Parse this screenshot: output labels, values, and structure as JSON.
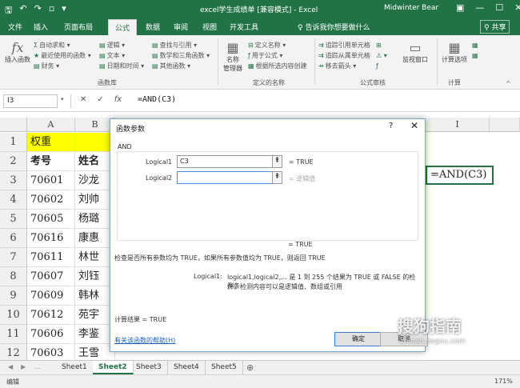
{
  "window": {
    "title": "excel学生成绩单 [兼容模式] - Excel",
    "user": "Midwinter Bear"
  },
  "ribbon_tabs": [
    "文件",
    "插入",
    "页面布局",
    "公式",
    "数据",
    "审阅",
    "视图",
    "开发工具"
  ],
  "active_tab_index": 3,
  "tell_me": "告诉我你想要做什么",
  "share": "共享",
  "ribbon": {
    "insert_function": "插入函数",
    "col1": [
      "自动求和",
      "最近使用的函数",
      "财务"
    ],
    "col2": [
      "逻辑",
      "文本",
      "日期和时间"
    ],
    "col3": [
      "查找与引用",
      "数学和三角函数",
      "其他函数"
    ],
    "group1_label": "函数库",
    "name_manager": "名称\n管理器",
    "col4": [
      "定义名称",
      "用于公式",
      "根据所选内容创建"
    ],
    "group2_label": "定义的名称",
    "col5": [
      "追踪引用单元格",
      "追踪从属单元格",
      "移去箭头"
    ],
    "col6": [
      "",
      "",
      ""
    ],
    "watch": "监视窗口",
    "group3_label": "公式审核",
    "calc_options": "计算选项",
    "group4_label": "计算"
  },
  "formula_bar": {
    "name_box": "I3",
    "formula": "=AND(C3)"
  },
  "grid": {
    "col_headers": [
      "A",
      "B",
      "I"
    ],
    "row_numbers": [
      "1",
      "2",
      "3",
      "4",
      "5",
      "6",
      "7",
      "8",
      "9",
      "10",
      "11",
      "12",
      "13"
    ],
    "colA": [
      "权重",
      "考号",
      "70601",
      "70602",
      "70605",
      "70616",
      "70611",
      "70607",
      "70609",
      "70612",
      "70606",
      "70603",
      "70604"
    ],
    "colB": [
      "",
      "姓名",
      "沙龙",
      "刘帅",
      "杨璐",
      "康惠",
      "林世",
      "刘钰",
      "韩林",
      "苑宇",
      "李鉴",
      "王雪",
      "韩雨"
    ],
    "selected_cell_text": "=AND(C3)"
  },
  "dialog": {
    "title": "函数参数",
    "help": "?",
    "close": "✕",
    "function_name": "AND",
    "logical1_label": "Logical1",
    "logical1_value": "C3",
    "logical1_result": "=  TRUE",
    "logical2_label": "Logical2",
    "logical2_value": "",
    "logical2_result": "=  逻辑值",
    "overall_result": "=  TRUE",
    "description": "检查是否所有参数均为 TRUE，如果所有参数值均为 TRUE，则返回 TRUE",
    "arg_desc_label": "Logical1:",
    "arg_desc_line1": "logical1,logical2,... 是 1 到 255 个结果为 TRUE 或 FALSE 的检测条",
    "arg_desc_line2": "件，检测内容可以是逻辑值、数组或引用",
    "calc_result": "计算结果 =   TRUE",
    "help_link": "有关该函数的帮助(H)",
    "ok": "确定",
    "cancel": "取消"
  },
  "sheets": [
    "Sheet1",
    "Sheet2",
    "Sheet3",
    "Sheet4",
    "Sheet5"
  ],
  "active_sheet_index": 1,
  "status": {
    "mode": "编辑",
    "zoom": "171%"
  },
  "watermark": {
    "text": "搜狗指南",
    "sub": "zhinan.sogou.com"
  },
  "colors": {
    "excel_green": "#217346",
    "highlight_yellow": "#ffff00",
    "arrow_red": "#e32323"
  }
}
